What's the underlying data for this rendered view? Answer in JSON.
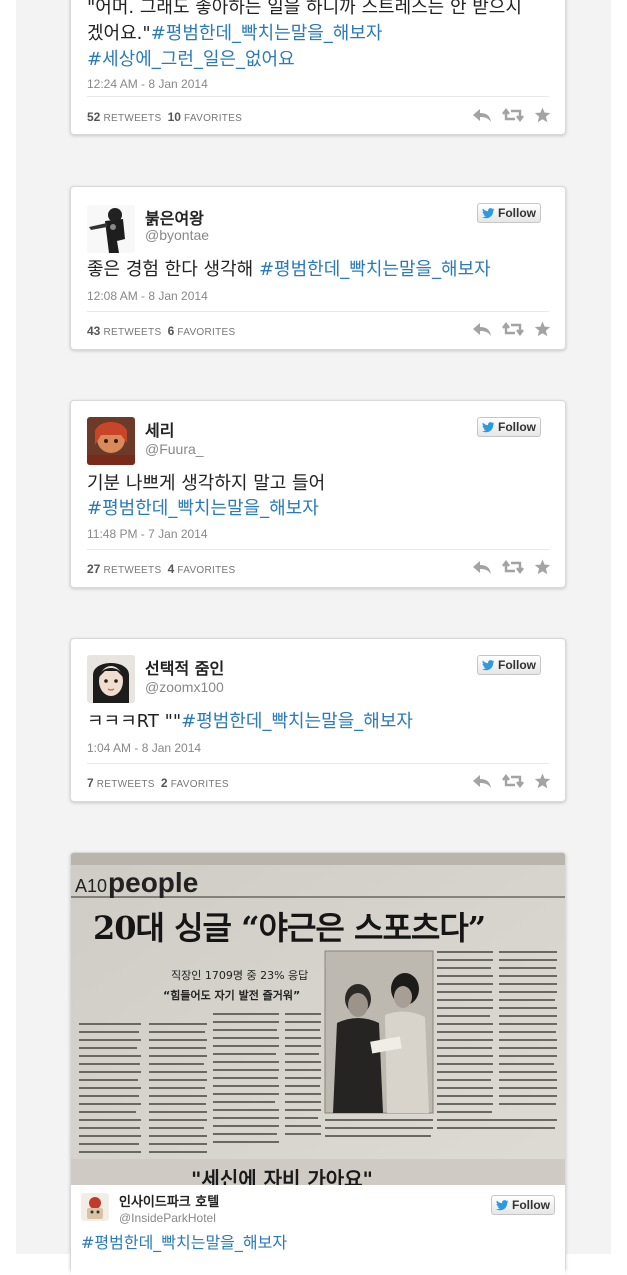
{
  "tweets": [
    {
      "text_plain": "\"어머. 그래도 좋아하는 일을 하니까 스트레스는 안 받으시겠어요.\"",
      "text_plain_line1": "\"어머. 그래도 좋아하는 일을 하니까 스트레스는 안 받으시",
      "text_plain_line2": "겠어요.\"",
      "hashtag1": "#평범한데_빡치는말을_해보자",
      "hashtag2": "#세상에_그런_일은_없어요",
      "timestamp": "12:24 AM - 8 Jan 2014",
      "retweets": "52",
      "favorites": "10"
    },
    {
      "display_name": "붉은여왕",
      "handle": "@byontae",
      "text_plain": "좋은 경험 한다 생각해 ",
      "hashtag1": "#평범한데_빡치는말을_해보자",
      "timestamp": "12:08 AM - 8 Jan 2014",
      "retweets": "43",
      "favorites": "6"
    },
    {
      "display_name": "세리",
      "handle": "@Fuura_",
      "text_plain": "기분 나쁘게 생각하지 말고 들어",
      "hashtag1": "#평범한데_빡치는말을_해보자",
      "timestamp": "11:48 PM - 7 Jan 2014",
      "retweets": "27",
      "favorites": "4"
    },
    {
      "display_name": "선택적 줌인",
      "handle": "@zoomx100",
      "text_plain": "ㅋㅋㅋRT \"\"",
      "hashtag1": "#평범한데_빡치는말을_해보자",
      "timestamp": "1:04 AM - 8 Jan 2014",
      "retweets": "7",
      "favorites": "2"
    },
    {
      "display_name": "인사이드파크 호텔",
      "handle": "@InsideParkHotel",
      "hashtag1": "#평범한데_빡치는말을_해보자"
    }
  ],
  "labels": {
    "follow": "Follow",
    "retweets": "RETWEETS",
    "favorites": "FAVORITES"
  },
  "newspaper": {
    "section": "A10",
    "section_word": "people",
    "headline": "20대 싱글 “야근은 스포츠다”",
    "sub1": "직장인 1709명 중 23% 응답",
    "sub2": "“힘들어도 자기 발전 즐거워”",
    "bottom_headline": "\"세신에 자비 가아요\""
  },
  "colors": {
    "hashtag": "#2b7bb9",
    "text": "#222222",
    "meta": "#888888",
    "page_bg": "#f3f3f3"
  },
  "icons": [
    "twitter-bird-icon",
    "reply-icon",
    "retweet-icon",
    "favorite-star-icon"
  ]
}
